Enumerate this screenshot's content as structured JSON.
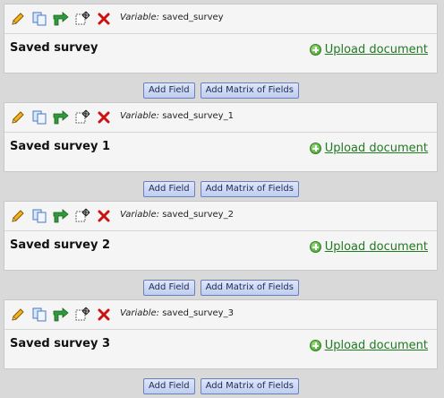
{
  "fields": [
    {
      "variable_label": "Variable:",
      "variable_name": "saved_survey",
      "title": "Saved survey",
      "upload_label": "Upload document"
    },
    {
      "variable_label": "Variable:",
      "variable_name": "saved_survey_1",
      "title": "Saved survey 1",
      "upload_label": "Upload document"
    },
    {
      "variable_label": "Variable:",
      "variable_name": "saved_survey_2",
      "title": "Saved survey 2",
      "upload_label": "Upload document"
    },
    {
      "variable_label": "Variable:",
      "variable_name": "saved_survey_3",
      "title": "Saved survey 3",
      "upload_label": "Upload document"
    }
  ],
  "buttons": {
    "add_field": "Add Field",
    "add_matrix": "Add Matrix of Fields"
  },
  "icons": [
    "pencil-icon",
    "copy-icon",
    "branch-arrow-icon",
    "move-icon",
    "delete-icon"
  ],
  "colors": {
    "upload_link": "#207a20",
    "delete": "#cc1111",
    "background": "#d9d9d9"
  }
}
